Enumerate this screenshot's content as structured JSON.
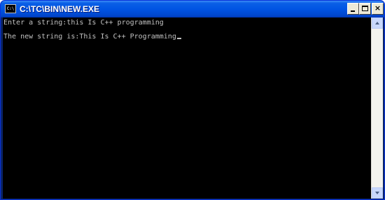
{
  "window": {
    "title": "C:\\TC\\BIN\\NEW.EXE",
    "icon_label": "C:\\"
  },
  "controls": {
    "minimize_icon": "minimize-icon",
    "maximize_icon": "maximize-icon",
    "close_glyph": "×",
    "close_icon": "close-icon"
  },
  "console": {
    "lines": [
      "Enter a string:this Is C++ programming",
      "The new string is:This Is C++ Programming"
    ],
    "foreground": "#c0c0c0",
    "background": "#000000"
  },
  "colors": {
    "titlebar": "#0054e3",
    "frame": "#0a246a"
  }
}
